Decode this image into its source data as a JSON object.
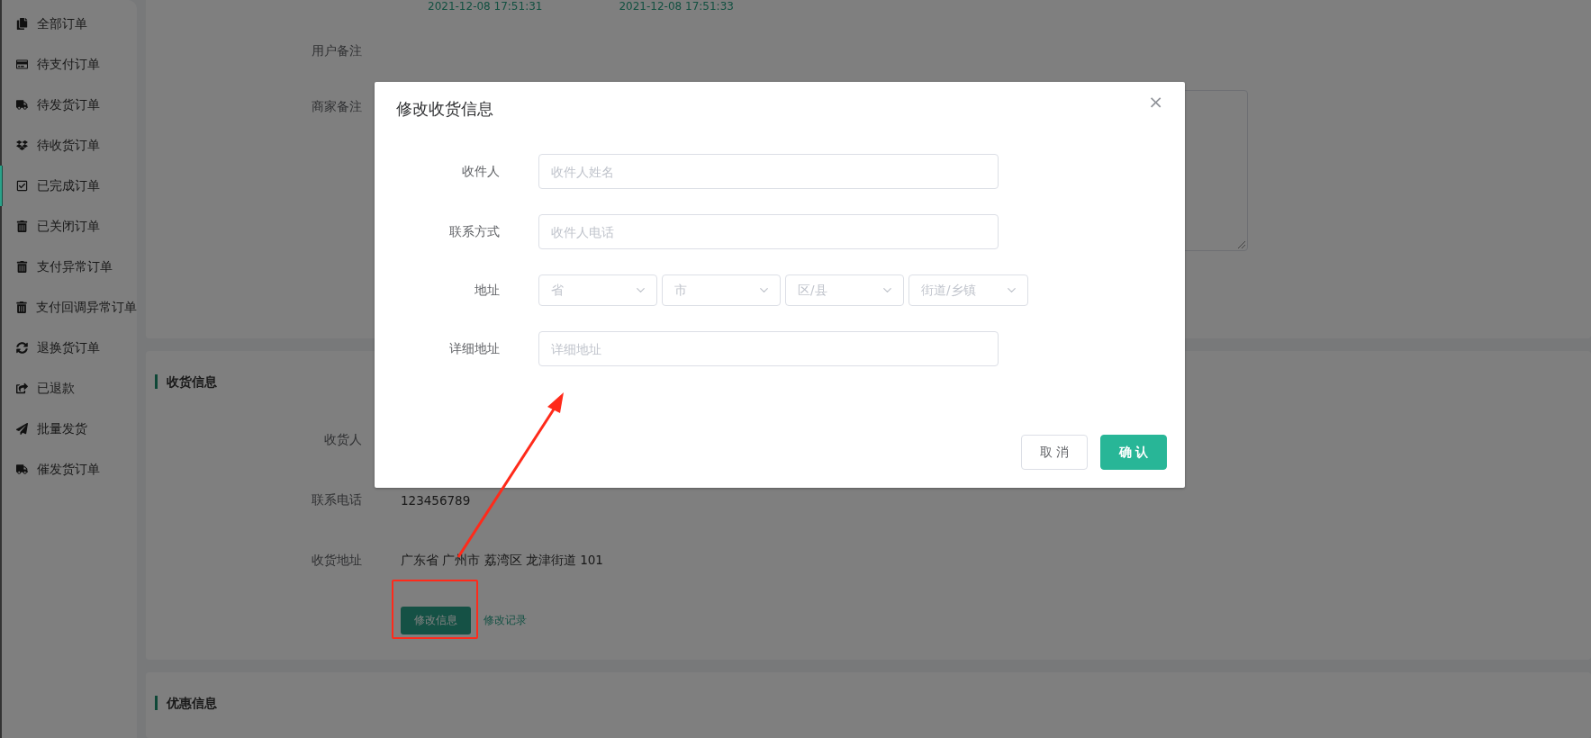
{
  "sidebar": {
    "items": [
      {
        "label": "全部订单",
        "selected": false
      },
      {
        "label": "待支付订单",
        "selected": false
      },
      {
        "label": "待发货订单",
        "selected": false
      },
      {
        "label": "待收货订单",
        "selected": false
      },
      {
        "label": "已完成订单",
        "selected": true
      },
      {
        "label": "已关闭订单",
        "selected": false
      },
      {
        "label": "支付异常订单",
        "selected": false
      },
      {
        "label": "支付回调异常订单",
        "selected": false
      },
      {
        "label": "退换货订单",
        "selected": false
      },
      {
        "label": "已退款",
        "selected": false
      },
      {
        "label": "批量发货",
        "selected": false
      },
      {
        "label": "催发货订单",
        "selected": false
      }
    ]
  },
  "order_panel": {
    "timestamps": [
      "2021-12-08 17:51:31",
      "2021-12-08 17:51:33"
    ],
    "rows": [
      {
        "label": "用户备注",
        "kind": "text"
      },
      {
        "label": "商家备注",
        "kind": "textarea"
      }
    ]
  },
  "shipping_panel": {
    "title": "收货信息",
    "rows": [
      {
        "label": "收货人",
        "value": ""
      },
      {
        "label": "联系电话",
        "value": "123456789"
      },
      {
        "label": "收货地址",
        "value": "广东省 广州市 荔湾区 龙津街道 101"
      }
    ],
    "actions": [
      {
        "label": "修改信息",
        "kind": "button"
      },
      {
        "label": "修改记录",
        "kind": "link"
      }
    ]
  },
  "discount_panel": {
    "title": "优惠信息"
  },
  "dialog": {
    "title": "修改收货信息",
    "close": "×",
    "fields": [
      {
        "label": "收件人",
        "kind": "input",
        "placeholder": "收件人姓名"
      },
      {
        "label": "联系方式",
        "kind": "input",
        "placeholder": "收件人电话"
      },
      {
        "label": "地址",
        "kind": "selects",
        "selects": [
          {
            "placeholder": "省"
          },
          {
            "placeholder": "市"
          },
          {
            "placeholder": "区/县"
          },
          {
            "placeholder": "街道/乡镇"
          }
        ]
      },
      {
        "label": "详细地址",
        "kind": "input",
        "placeholder": "详细地址"
      }
    ],
    "buttons": [
      {
        "label": "取 消",
        "kind": "secondary"
      },
      {
        "label": "确 认",
        "kind": "primary"
      }
    ]
  }
}
